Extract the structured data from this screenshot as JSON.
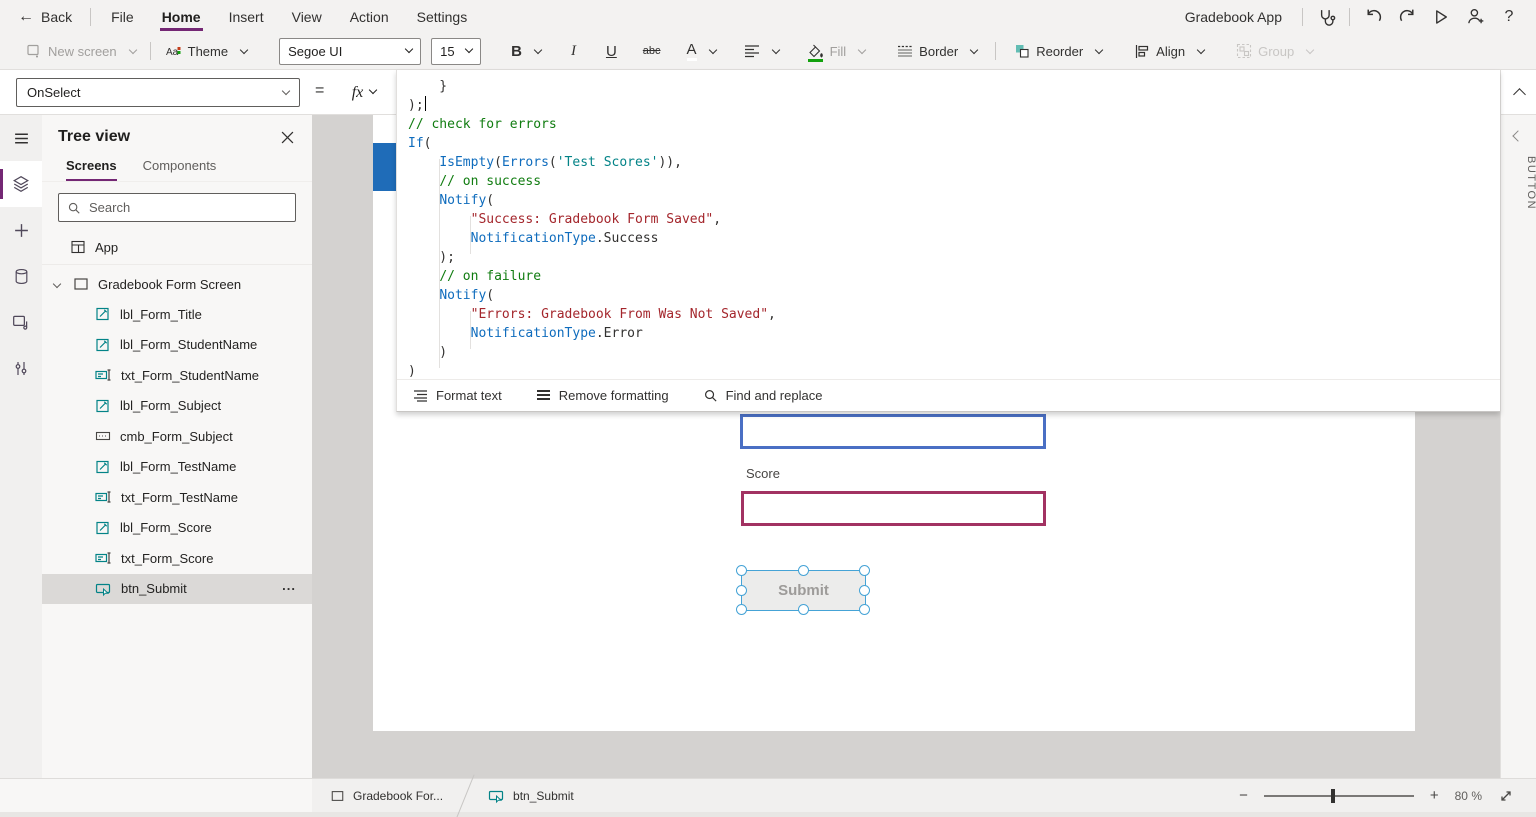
{
  "colors": {
    "accent": "#742774",
    "code_plain": "#323130",
    "code_func": "#0f6cbd",
    "code_comment": "#107c10",
    "code_string": "#a4262c",
    "code_entity": "#038387",
    "input_blue_border": "#4a6fc4",
    "input_maroon_border": "#a23262",
    "selection_blue": "#45a3d6",
    "title_bar_blue": "#1f6cb8"
  },
  "menubar": {
    "back_label": "Back",
    "items": [
      {
        "label": "File",
        "active": false
      },
      {
        "label": "Home",
        "active": true
      },
      {
        "label": "Insert",
        "active": false
      },
      {
        "label": "View",
        "active": false
      },
      {
        "label": "Action",
        "active": false
      },
      {
        "label": "Settings",
        "active": false
      }
    ],
    "app_name": "Gradebook App"
  },
  "toolbar": {
    "new_screen": "New screen",
    "theme": "Theme",
    "font_name": "Segoe UI",
    "font_size": "15",
    "bold": "B",
    "italic": "I",
    "underline": "U",
    "strikethrough": "abc",
    "font_color": "A",
    "fill": "Fill",
    "border": "Border",
    "reorder": "Reorder",
    "align": "Align",
    "group": "Group"
  },
  "formula_bar": {
    "property": "OnSelect",
    "equals": "=",
    "fx": "fx",
    "cursor_line": 1,
    "code_lines": [
      [
        [
          "p",
          "    }"
        ]
      ],
      [
        [
          "p",
          ");"
        ]
      ],
      [
        [
          "c",
          "// check for errors"
        ]
      ],
      [
        [
          "f",
          "If"
        ],
        [
          "p",
          "("
        ]
      ],
      [
        [
          "p",
          "    "
        ],
        [
          "f",
          "IsEmpty"
        ],
        [
          "p",
          "("
        ],
        [
          "f",
          "Errors"
        ],
        [
          "p",
          "("
        ],
        [
          "i",
          "'Test Scores'"
        ],
        [
          "p",
          ")),"
        ]
      ],
      [
        [
          "p",
          "    "
        ],
        [
          "c",
          "// on success"
        ]
      ],
      [
        [
          "p",
          "    "
        ],
        [
          "f",
          "Notify"
        ],
        [
          "p",
          "("
        ]
      ],
      [
        [
          "p",
          "        "
        ],
        [
          "s",
          "\"Success: Gradebook Form Saved\""
        ],
        [
          "p",
          ","
        ]
      ],
      [
        [
          "p",
          "        "
        ],
        [
          "f",
          "NotificationType"
        ],
        [
          "p",
          ".Success"
        ]
      ],
      [
        [
          "p",
          "    );"
        ]
      ],
      [
        [
          "p",
          "    "
        ],
        [
          "c",
          "// on failure"
        ]
      ],
      [
        [
          "p",
          "    "
        ],
        [
          "f",
          "Notify"
        ],
        [
          "p",
          "("
        ]
      ],
      [
        [
          "p",
          "        "
        ],
        [
          "s",
          "\"Errors: Gradebook From Was Not Saved\""
        ],
        [
          "p",
          ","
        ]
      ],
      [
        [
          "p",
          "        "
        ],
        [
          "f",
          "NotificationType"
        ],
        [
          "p",
          ".Error"
        ]
      ],
      [
        [
          "p",
          "    )"
        ]
      ],
      [
        [
          "p",
          ")"
        ]
      ]
    ],
    "actions": [
      "Format text",
      "Remove formatting",
      "Find and replace"
    ]
  },
  "left_rail": {
    "icons": [
      "menu-icon",
      "tree-view-icon",
      "insert-icon",
      "data-icon",
      "media-icon",
      "advanced-tools-icon"
    ],
    "selected_index": 1
  },
  "tree": {
    "title": "Tree view",
    "tabs": [
      {
        "label": "Screens",
        "active": true
      },
      {
        "label": "Components",
        "active": false
      }
    ],
    "search_placeholder": "Search",
    "app_label": "App",
    "screen_label": "Gradebook Form Screen",
    "children": [
      {
        "name": "lbl_Form_Title",
        "type": "label",
        "selected": false
      },
      {
        "name": "lbl_Form_StudentName",
        "type": "label",
        "selected": false
      },
      {
        "name": "txt_Form_StudentName",
        "type": "textinput",
        "selected": false
      },
      {
        "name": "lbl_Form_Subject",
        "type": "label",
        "selected": false
      },
      {
        "name": "cmb_Form_Subject",
        "type": "combobox",
        "selected": false
      },
      {
        "name": "lbl_Form_TestName",
        "type": "label",
        "selected": false
      },
      {
        "name": "txt_Form_TestName",
        "type": "textinput",
        "selected": false
      },
      {
        "name": "lbl_Form_Score",
        "type": "label",
        "selected": false
      },
      {
        "name": "txt_Form_Score",
        "type": "textinput",
        "selected": false
      },
      {
        "name": "btn_Submit",
        "type": "button",
        "selected": true
      }
    ],
    "ellipsis": "..."
  },
  "canvas": {
    "score_label": "Score",
    "submit_label": "Submit",
    "text_inputs": [
      {
        "border": "blue",
        "value": ""
      },
      {
        "border": "maroon",
        "value": ""
      }
    ]
  },
  "right_rail": {
    "panel_label": "BUTTON"
  },
  "statusbar": {
    "breadcrumbs": [
      {
        "label": "Gradebook For...",
        "icon": "screen-icon"
      },
      {
        "label": "btn_Submit",
        "icon": "button-icon"
      }
    ],
    "zoom_value": "80",
    "zoom_unit": "%",
    "zoom_minus": "−",
    "zoom_plus": "+"
  }
}
